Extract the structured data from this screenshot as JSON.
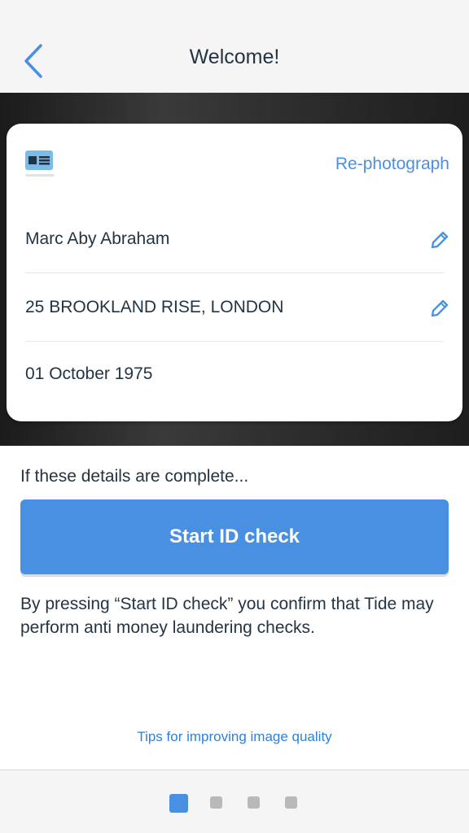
{
  "header": {
    "title": "Welcome!",
    "back_icon": "chevron-left-icon"
  },
  "card": {
    "document_icon": "id-card-icon",
    "rephotograph_label": "Re-photograph",
    "fields": [
      {
        "value": "Marc Aby Abraham",
        "editable": true
      },
      {
        "value": "25 BROOKLAND RISE, LONDON",
        "editable": true
      },
      {
        "value": "01 October 1975",
        "editable": false
      }
    ]
  },
  "main": {
    "prompt": "If these details are complete...",
    "start_button_label": "Start ID check",
    "confirm_text": "By pressing “Start ID check” you confirm that Tide may perform anti money laundering checks.",
    "tips_link": "Tips for improving image quality"
  },
  "pagination": {
    "total": 4,
    "current": 1
  },
  "colors": {
    "accent": "#4a90e2",
    "text": "#233544",
    "link": "#2f80d8",
    "inactive_dot": "#b9b9b9"
  }
}
